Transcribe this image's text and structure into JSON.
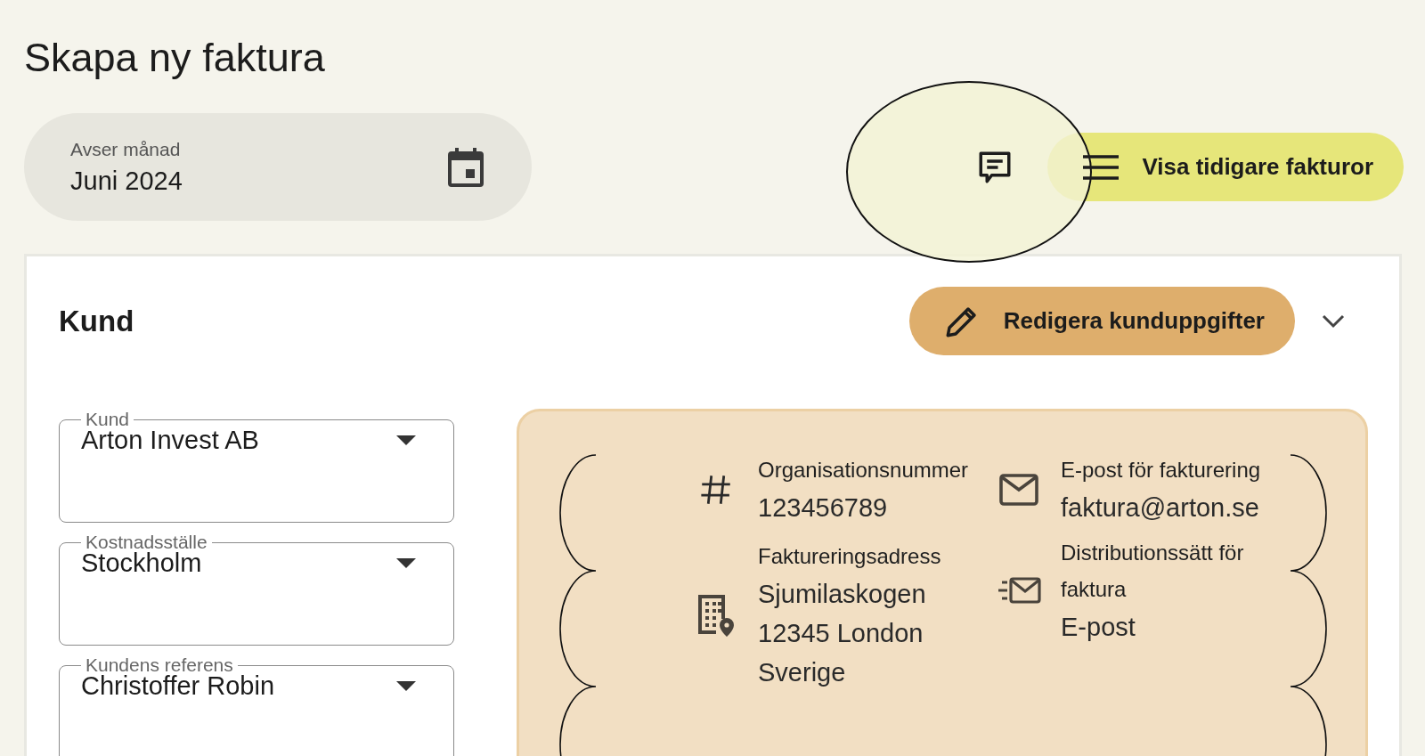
{
  "page": {
    "title": "Skapa ny faktura"
  },
  "month_field": {
    "label": "Avser månad",
    "value": "Juni 2024"
  },
  "history_button": {
    "label": "Visa tidigare fakturor"
  },
  "customer_section": {
    "title": "Kund",
    "edit_button": {
      "label": "Redigera kunduppgifter"
    },
    "fields": [
      {
        "label": "Kund",
        "value": "Arton Invest AB"
      },
      {
        "label": "Kostnadsställe",
        "value": "Stockholm"
      },
      {
        "label": "Kundens referens",
        "value": "Christoffer Robin"
      }
    ],
    "info": {
      "left": [
        {
          "kind": "number",
          "label": "Organisationsnummer",
          "lines": [
            "123456789"
          ]
        },
        {
          "kind": "address",
          "label": "Faktureringsadress",
          "lines": [
            "Sjumilaskogen",
            "12345 London",
            "Sverige"
          ]
        }
      ],
      "right": [
        {
          "kind": "email",
          "label": "E-post för fakturering",
          "lines": [
            "faktura@arton.se"
          ]
        },
        {
          "kind": "distribution",
          "label": "Distributionssätt för faktura",
          "lines": [
            "E-post"
          ]
        }
      ]
    }
  }
}
